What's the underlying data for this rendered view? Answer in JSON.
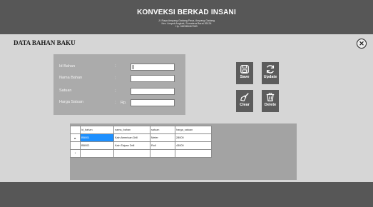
{
  "header": {
    "title": "KONVEKSI BERKAD INSANI",
    "address_lines": [
      "Jl. Raya Ampang Gadang Pasa, Ampang Gadang",
      "Kec. Ampek Angkek, Sumatera Barat 26134",
      "Hp. 082385467383"
    ]
  },
  "page": {
    "title": "DATA BAHAN BAKU",
    "close_icon": "x-circle-icon"
  },
  "form": {
    "fields": [
      {
        "label": "Id Bahan",
        "colon": ":",
        "value": ""
      },
      {
        "label": "Nama Bahan",
        "colon": ":",
        "value": ""
      },
      {
        "label": "Satuan",
        "colon": ":",
        "value": ""
      },
      {
        "label": "Harga Satuan",
        "colon": ":",
        "prefix": "Rp.",
        "value": ""
      }
    ]
  },
  "buttons": {
    "save": {
      "label": "Save",
      "icon": "save-icon"
    },
    "update": {
      "label": "Update",
      "icon": "refresh-icon"
    },
    "clear": {
      "label": "Clear",
      "icon": "broom-icon"
    },
    "delete": {
      "label": "Delete",
      "icon": "trash-icon"
    }
  },
  "grid": {
    "columns": [
      "id_bahan",
      "nama_bahan",
      "satuan",
      "harga_satuan"
    ],
    "rows": [
      {
        "marker": "▸",
        "cells": [
          "BB001",
          "Kain American Drill",
          "Meter",
          "28000"
        ]
      },
      {
        "marker": "",
        "cells": [
          "BB002",
          "Kain Taipan Drill",
          "Roll",
          "43000"
        ]
      },
      {
        "marker": "*",
        "cells": [
          "",
          "",
          "",
          ""
        ]
      }
    ]
  },
  "colors": {
    "header_bg": "#575757",
    "selection": "#1e90ff",
    "button_bg": "#5c5c5c"
  }
}
